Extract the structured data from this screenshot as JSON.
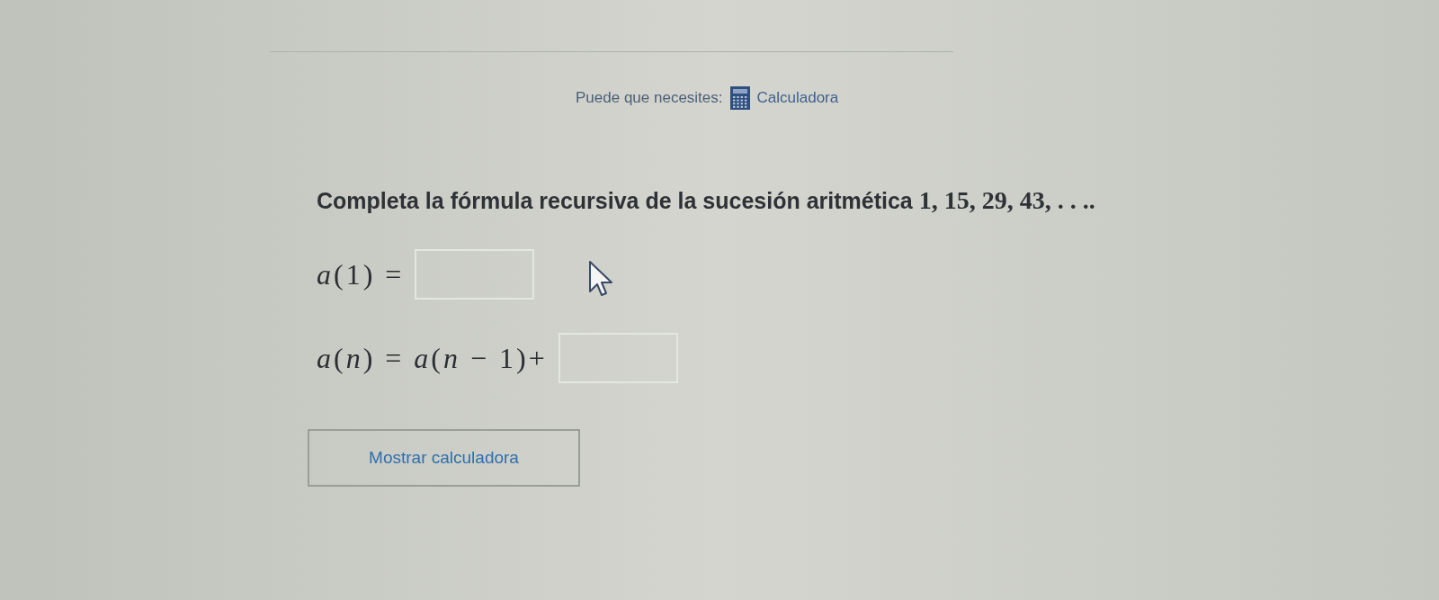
{
  "resources": {
    "label": "Puede que necesites:",
    "link": "Calculadora"
  },
  "question": {
    "text": "Completa la fórmula recursiva de la sucesión aritmética",
    "sequence": "1, 15, 29, 43, . . .."
  },
  "equations": [
    {
      "expression": "*a*(1) ="
    },
    {
      "expression": "*a*(*n*) = *a*(*n* − 1)+"
    }
  ],
  "calculator_button": {
    "label": "Mostrar calculadora"
  }
}
